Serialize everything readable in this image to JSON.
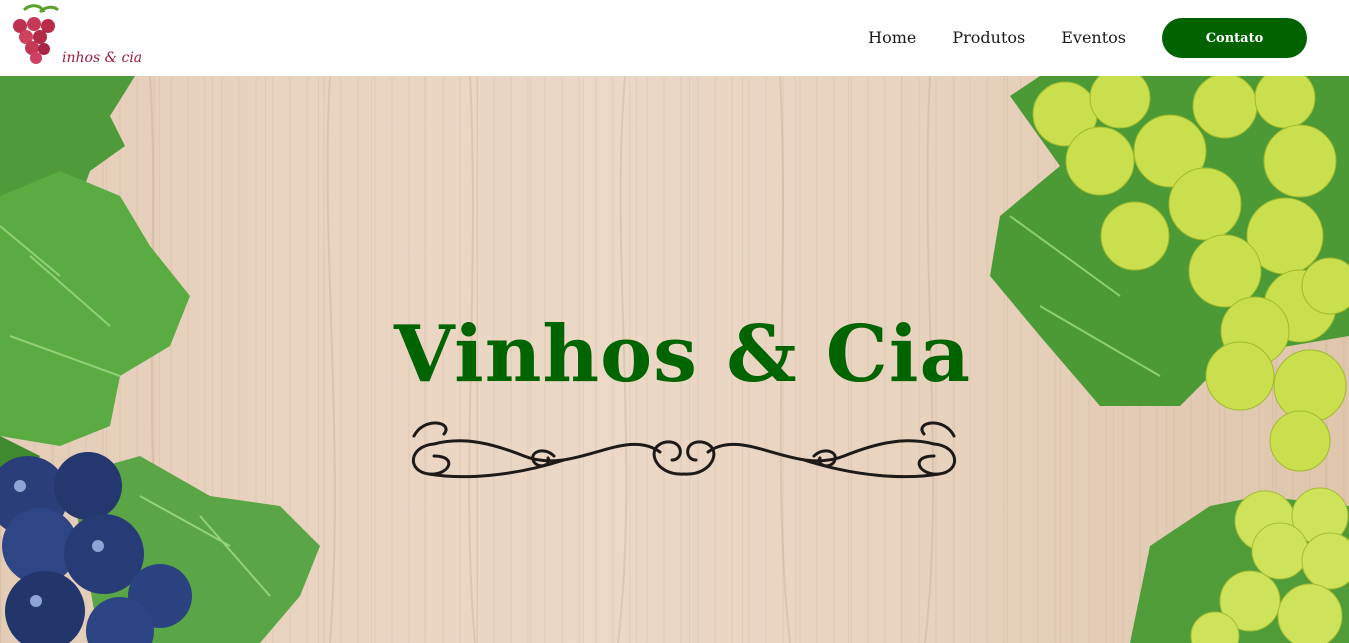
{
  "header": {
    "logo_text": "inhos & cia",
    "nav": {
      "home": "Home",
      "produtos": "Produtos",
      "eventos": "Eventos",
      "contato": "Contato"
    }
  },
  "hero": {
    "title": "Vinhos & Cia"
  },
  "colors": {
    "brand_green": "#016200",
    "title_green": "#006400",
    "logo_wine": "#9b1b3a"
  },
  "icons": [
    "grape-logo-icon",
    "ornament-flourish"
  ]
}
